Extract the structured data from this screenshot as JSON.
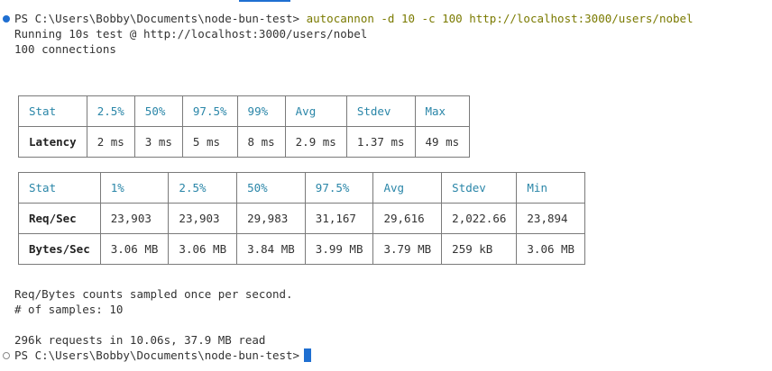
{
  "terminal": {
    "prompt": "PS C:\\Users\\Bobby\\Documents\\node-bun-test>",
    "command": "autocannon -d 10 -c 100 http://localhost:3000/users/nobel",
    "running": "Running 10s test @ http://localhost:3000/users/nobel",
    "connections": "100 connections",
    "sampled_note": "Req/Bytes counts sampled once per second.",
    "samples": "# of samples: 10",
    "summary": "296k requests in 10.06s, 37.9 MB read",
    "final_prompt": "PS C:\\Users\\Bobby\\Documents\\node-bun-test>"
  },
  "latency_table": {
    "headers": [
      "Stat",
      "2.5%",
      "50%",
      "97.5%",
      "99%",
      "Avg",
      "Stdev",
      "Max"
    ],
    "rows": [
      [
        "Latency",
        "2 ms",
        "3 ms",
        "5 ms",
        "8 ms",
        "2.9 ms",
        "1.37 ms",
        "49 ms"
      ]
    ]
  },
  "throughput_table": {
    "headers": [
      "Stat",
      "1%",
      "2.5%",
      "50%",
      "97.5%",
      "Avg",
      "Stdev",
      "Min"
    ],
    "rows": [
      [
        "Req/Sec",
        "23,903",
        "23,903",
        "29,983",
        "31,167",
        "29,616",
        "2,022.66",
        "23,894"
      ],
      [
        "Bytes/Sec",
        "3.06 MB",
        "3.06 MB",
        "3.84 MB",
        "3.99 MB",
        "3.79 MB",
        "259 kB",
        "3.06 MB"
      ]
    ]
  },
  "colors": {
    "accent": "#1f6fd1",
    "header_text": "#2a86a8",
    "command_text": "#7a7a00",
    "border": "#7a7a7a"
  }
}
